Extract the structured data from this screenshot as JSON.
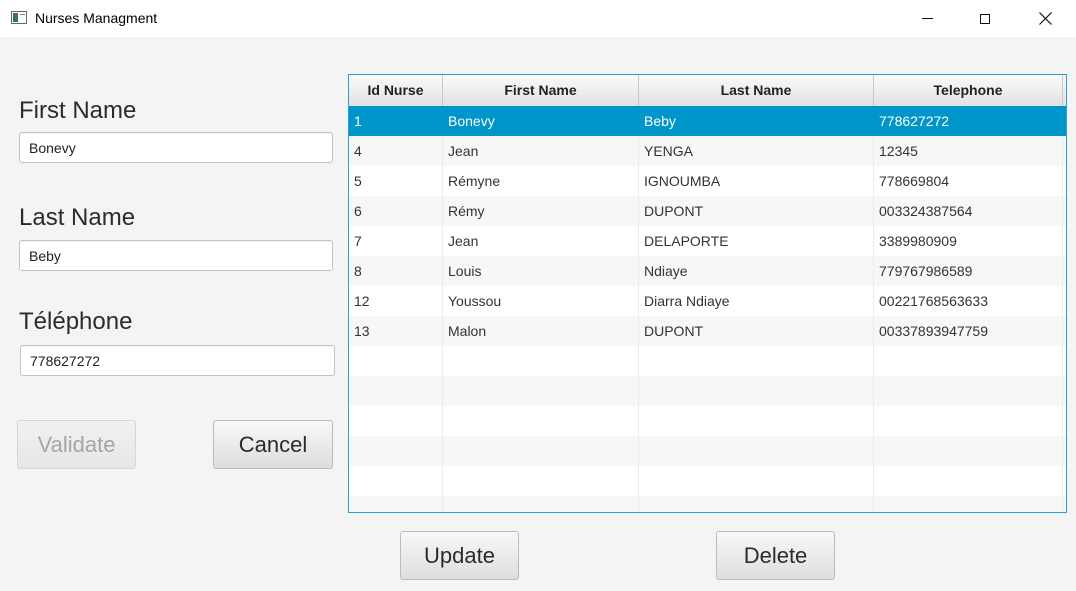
{
  "window": {
    "title": "Nurses Managment"
  },
  "form": {
    "first_name_label": "First Name",
    "first_name_value": "Bonevy",
    "last_name_label": "Last Name",
    "last_name_value": "Beby",
    "telephone_label": "Téléphone",
    "telephone_value": "778627272",
    "validate_label": "Validate",
    "cancel_label": "Cancel"
  },
  "table": {
    "headers": [
      "Id Nurse",
      "First Name",
      "Last Name",
      "Telephone"
    ],
    "selected_row": 0,
    "rows": [
      {
        "id": "1",
        "first": "Bonevy",
        "last": "Beby",
        "tel": "778627272"
      },
      {
        "id": "4",
        "first": "Jean",
        "last": "YENGA",
        "tel": "12345"
      },
      {
        "id": "5",
        "first": "Rémyne",
        "last": "IGNOUMBA",
        "tel": "778669804"
      },
      {
        "id": "6",
        "first": "Rémy",
        "last": "DUPONT",
        "tel": "003324387564"
      },
      {
        "id": "7",
        "first": "Jean",
        "last": "DELAPORTE",
        "tel": "3389980909"
      },
      {
        "id": "8",
        "first": "Louis",
        "last": "Ndiaye",
        "tel": "779767986589"
      },
      {
        "id": "12",
        "first": "Youssou",
        "last": "Diarra Ndiaye",
        "tel": "00221768563633"
      },
      {
        "id": "13",
        "first": "Malon",
        "last": "DUPONT",
        "tel": "00337893947759"
      }
    ]
  },
  "actions": {
    "update_label": "Update",
    "delete_label": "Delete"
  },
  "colors": {
    "selection": "#0096c9",
    "table_border": "#2d9bd6"
  }
}
